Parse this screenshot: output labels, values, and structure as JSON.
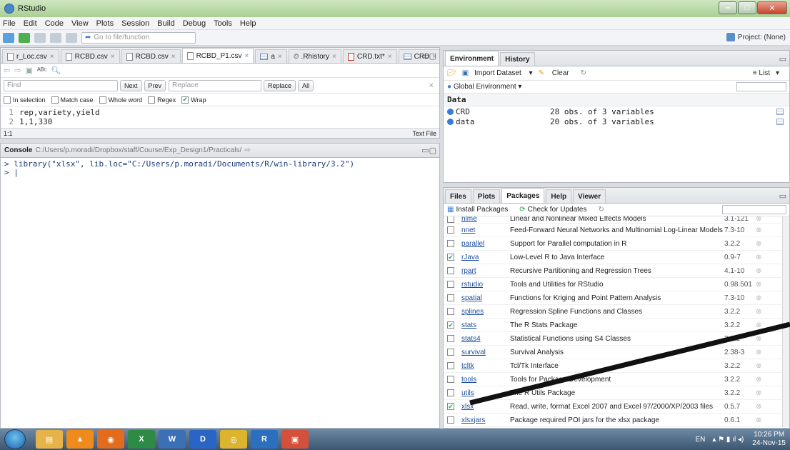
{
  "window": {
    "title": "RStudio"
  },
  "menu": [
    "File",
    "Edit",
    "Code",
    "View",
    "Plots",
    "Session",
    "Build",
    "Debug",
    "Tools",
    "Help"
  ],
  "toolbar": {
    "goto_placeholder": "Go to file/function",
    "project": "Project: (None)"
  },
  "source": {
    "tabs": [
      {
        "label": "r_Loc.csv",
        "kind": "file",
        "active": false
      },
      {
        "label": "RCBD.csv",
        "kind": "file",
        "active": false
      },
      {
        "label": "RCBD.csv",
        "kind": "file",
        "active": false
      },
      {
        "label": "RCBD_P1.csv",
        "kind": "file",
        "active": true
      },
      {
        "label": "a",
        "kind": "table",
        "active": false
      },
      {
        "label": ".Rhistory",
        "kind": "history",
        "active": false
      },
      {
        "label": "CRD.txt*",
        "kind": "file-red",
        "active": false
      },
      {
        "label": "CRD",
        "kind": "table",
        "active": false
      }
    ],
    "find_placeholder": "Find",
    "replace_placeholder": "Replace",
    "find_buttons": {
      "next": "Next",
      "prev": "Prev",
      "replace": "Replace",
      "all": "All"
    },
    "options": [
      {
        "label": "In selection",
        "checked": false
      },
      {
        "label": "Match case",
        "checked": false
      },
      {
        "label": "Whole word",
        "checked": false
      },
      {
        "label": "Regex",
        "checked": false
      },
      {
        "label": "Wrap",
        "checked": true
      }
    ],
    "lines": [
      {
        "num": "1",
        "text": "rep,variety,yield"
      },
      {
        "num": "2",
        "text": "1,1,330"
      }
    ],
    "status_pos": "1:1",
    "status_type": "Text File"
  },
  "console": {
    "title": "Console",
    "path": "C:/Users/p.moradi/Dropbox/staff/Course/Exp_Design1/Practicals/",
    "lines": [
      "> library(\"xlsx\", lib.loc=\"C:/Users/p.moradi/Documents/R/win-library/3.2\")",
      "> |"
    ]
  },
  "environment": {
    "tabs": [
      "Environment",
      "History"
    ],
    "import_label": "Import Dataset",
    "clear_label": "Clear",
    "list_label": "List",
    "scope": "Global Environment",
    "section": "Data",
    "rows": [
      {
        "name": "CRD",
        "desc": "28 obs. of 3 variables"
      },
      {
        "name": "data",
        "desc": "20 obs. of 3 variables"
      }
    ]
  },
  "files": {
    "tabs": [
      "Files",
      "Plots",
      "Packages",
      "Help",
      "Viewer"
    ],
    "install_label": "Install Packages",
    "update_label": "Check for Updates",
    "packages": [
      {
        "name": "nlme",
        "desc": "Linear and Nonlinear Mixed Effects Models",
        "ver": "3.1-121",
        "checked": false
      },
      {
        "name": "nnet",
        "desc": "Feed-Forward Neural Networks and Multinomial Log-Linear Models",
        "ver": "7.3-10",
        "checked": false
      },
      {
        "name": "parallel",
        "desc": "Support for Parallel computation in R",
        "ver": "3.2.2",
        "checked": false
      },
      {
        "name": "rJava",
        "desc": "Low-Level R to Java Interface",
        "ver": "0.9-7",
        "checked": true
      },
      {
        "name": "rpart",
        "desc": "Recursive Partitioning and Regression Trees",
        "ver": "4.1-10",
        "checked": false
      },
      {
        "name": "rstudio",
        "desc": "Tools and Utilities for RStudio",
        "ver": "0.98.501",
        "checked": false
      },
      {
        "name": "spatial",
        "desc": "Functions for Kriging and Point Pattern Analysis",
        "ver": "7.3-10",
        "checked": false
      },
      {
        "name": "splines",
        "desc": "Regression Spline Functions and Classes",
        "ver": "3.2.2",
        "checked": false
      },
      {
        "name": "stats",
        "desc": "The R Stats Package",
        "ver": "3.2.2",
        "checked": true
      },
      {
        "name": "stats4",
        "desc": "Statistical Functions using S4 Classes",
        "ver": "3.2.2",
        "checked": false
      },
      {
        "name": "survival",
        "desc": "Survival Analysis",
        "ver": "2.38-3",
        "checked": false
      },
      {
        "name": "tcltk",
        "desc": "Tcl/Tk Interface",
        "ver": "3.2.2",
        "checked": false
      },
      {
        "name": "tools",
        "desc": "Tools for Package Development",
        "ver": "3.2.2",
        "checked": false
      },
      {
        "name": "utils",
        "desc": "The R Utils Package",
        "ver": "3.2.2",
        "checked": false
      },
      {
        "name": "xlsx",
        "desc": "Read, write, format Excel 2007 and Excel 97/2000/XP/2003 files",
        "ver": "0.5.7",
        "checked": true
      },
      {
        "name": "xlsxjars",
        "desc": "Package required POI jars for the xlsx package",
        "ver": "0.6.1",
        "checked": false
      }
    ]
  },
  "taskbar": {
    "lang": "EN",
    "time": "10:26 PM",
    "date": "24-Nov-15"
  }
}
